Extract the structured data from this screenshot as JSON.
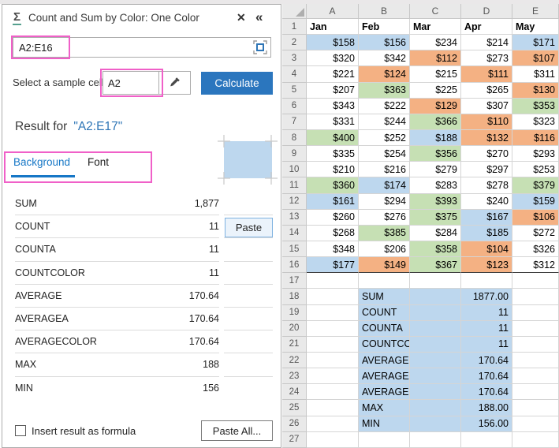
{
  "colors": {
    "annotation_pink": "#F060C8",
    "accent_blue": "#2B76BE",
    "tab_blue": "#1677C6",
    "swatch_blue": "#BDD7EE",
    "fill_blue": "#BDD7EE",
    "fill_orange": "#F4B183",
    "fill_green": "#C6E0B4"
  },
  "icons": {
    "sigma": "Σ",
    "close": "✕",
    "collapse": "«"
  },
  "panel": {
    "title": "Count and Sum by Color: One Color",
    "range_input": {
      "value": "A2:E16"
    },
    "sample_label": "Select a sample cell",
    "sample_input": {
      "value": "A2"
    },
    "calculate_button": "Calculate",
    "result_for_label": "Result for",
    "result_for_range": "\"A2:E17\"",
    "tabs": [
      {
        "label": "Background",
        "active": true
      },
      {
        "label": "Font",
        "active": false
      }
    ],
    "results": [
      {
        "label": "SUM",
        "value": "1,877"
      },
      {
        "label": "COUNT",
        "value": "11",
        "paste": true
      },
      {
        "label": "COUNTA",
        "value": "11"
      },
      {
        "label": "COUNTCOLOR",
        "value": "11"
      },
      {
        "label": "AVERAGE",
        "value": "170.64"
      },
      {
        "label": "AVERAGEA",
        "value": "170.64"
      },
      {
        "label": "AVERAGECOLOR",
        "value": "170.64"
      },
      {
        "label": "MAX",
        "value": "188"
      },
      {
        "label": "MIN",
        "value": "156"
      }
    ],
    "paste_button": "Paste",
    "footer": {
      "checkbox_label": "Insert result as formula",
      "checked": false,
      "paste_all_button": "Paste All..."
    }
  },
  "sheet": {
    "columns": [
      "A",
      "B",
      "C",
      "D",
      "E"
    ],
    "fills": {
      "b": "#BDD7EE",
      "o": "#F4B183",
      "g": "#C6E0B4",
      "w": "#FFFFFF"
    },
    "rows": [
      {
        "n": 1,
        "type": "months",
        "cells": [
          "Jan",
          "Feb",
          "Mar",
          "Apr",
          "May"
        ]
      },
      {
        "n": 2,
        "type": "data",
        "cells": [
          [
            "$158",
            "b"
          ],
          [
            "$156",
            "b"
          ],
          [
            "$234",
            "w"
          ],
          [
            "$214",
            "w"
          ],
          [
            "$171",
            "b"
          ]
        ]
      },
      {
        "n": 3,
        "type": "data",
        "cells": [
          [
            "$320",
            "w"
          ],
          [
            "$342",
            "w"
          ],
          [
            "$112",
            "o"
          ],
          [
            "$273",
            "w"
          ],
          [
            "$107",
            "o"
          ]
        ]
      },
      {
        "n": 4,
        "type": "data",
        "cells": [
          [
            "$221",
            "w"
          ],
          [
            "$124",
            "o"
          ],
          [
            "$215",
            "w"
          ],
          [
            "$111",
            "o"
          ],
          [
            "$311",
            "w"
          ]
        ]
      },
      {
        "n": 5,
        "type": "data",
        "cells": [
          [
            "$207",
            "w"
          ],
          [
            "$363",
            "g"
          ],
          [
            "$225",
            "w"
          ],
          [
            "$265",
            "w"
          ],
          [
            "$130",
            "o"
          ]
        ]
      },
      {
        "n": 6,
        "type": "data",
        "cells": [
          [
            "$343",
            "w"
          ],
          [
            "$222",
            "w"
          ],
          [
            "$129",
            "o"
          ],
          [
            "$307",
            "w"
          ],
          [
            "$353",
            "g"
          ]
        ]
      },
      {
        "n": 7,
        "type": "data",
        "cells": [
          [
            "$331",
            "w"
          ],
          [
            "$244",
            "w"
          ],
          [
            "$366",
            "g"
          ],
          [
            "$110",
            "o"
          ],
          [
            "$323",
            "w"
          ]
        ]
      },
      {
        "n": 8,
        "type": "data",
        "cells": [
          [
            "$400",
            "g"
          ],
          [
            "$252",
            "w"
          ],
          [
            "$188",
            "b"
          ],
          [
            "$132",
            "o"
          ],
          [
            "$116",
            "o"
          ]
        ]
      },
      {
        "n": 9,
        "type": "data",
        "cells": [
          [
            "$335",
            "w"
          ],
          [
            "$254",
            "w"
          ],
          [
            "$356",
            "g"
          ],
          [
            "$270",
            "w"
          ],
          [
            "$293",
            "w"
          ]
        ]
      },
      {
        "n": 10,
        "type": "data",
        "cells": [
          [
            "$210",
            "w"
          ],
          [
            "$216",
            "w"
          ],
          [
            "$279",
            "w"
          ],
          [
            "$297",
            "w"
          ],
          [
            "$253",
            "w"
          ]
        ]
      },
      {
        "n": 11,
        "type": "data",
        "cells": [
          [
            "$360",
            "g"
          ],
          [
            "$174",
            "b"
          ],
          [
            "$283",
            "w"
          ],
          [
            "$278",
            "w"
          ],
          [
            "$379",
            "g"
          ]
        ]
      },
      {
        "n": 12,
        "type": "data",
        "cells": [
          [
            "$161",
            "b"
          ],
          [
            "$294",
            "w"
          ],
          [
            "$393",
            "g"
          ],
          [
            "$240",
            "w"
          ],
          [
            "$159",
            "b"
          ]
        ]
      },
      {
        "n": 13,
        "type": "data",
        "cells": [
          [
            "$260",
            "w"
          ],
          [
            "$276",
            "w"
          ],
          [
            "$375",
            "g"
          ],
          [
            "$167",
            "b"
          ],
          [
            "$106",
            "o"
          ]
        ]
      },
      {
        "n": 14,
        "type": "data",
        "cells": [
          [
            "$268",
            "w"
          ],
          [
            "$385",
            "g"
          ],
          [
            "$284",
            "w"
          ],
          [
            "$185",
            "b"
          ],
          [
            "$272",
            "w"
          ]
        ]
      },
      {
        "n": 15,
        "type": "data",
        "cells": [
          [
            "$348",
            "w"
          ],
          [
            "$206",
            "w"
          ],
          [
            "$358",
            "g"
          ],
          [
            "$104",
            "o"
          ],
          [
            "$326",
            "w"
          ]
        ]
      },
      {
        "n": 16,
        "type": "data",
        "cells": [
          [
            "$177",
            "b"
          ],
          [
            "$149",
            "o"
          ],
          [
            "$367",
            "g"
          ],
          [
            "$123",
            "o"
          ],
          [
            "$312",
            "w"
          ]
        ]
      },
      {
        "n": 17,
        "type": "empty"
      },
      {
        "n": 18,
        "type": "summary",
        "label": "SUM",
        "value": "1877.00"
      },
      {
        "n": 19,
        "type": "summary",
        "label": "COUNT",
        "value": "11"
      },
      {
        "n": 20,
        "type": "summary",
        "label": "COUNTA",
        "value": "11"
      },
      {
        "n": 21,
        "type": "summary",
        "label": "COUNTCOLOR",
        "value": "11"
      },
      {
        "n": 22,
        "type": "summary",
        "label": "AVERAGE",
        "value": "170.64"
      },
      {
        "n": 23,
        "type": "summary",
        "label": "AVERAGEA",
        "value": "170.64"
      },
      {
        "n": 24,
        "type": "summary",
        "label": "AVERAGECOLOR",
        "value": "170.64"
      },
      {
        "n": 25,
        "type": "summary",
        "label": "MAX",
        "value": "188.00"
      },
      {
        "n": 26,
        "type": "summary",
        "label": "MIN",
        "value": "156.00"
      },
      {
        "n": 27,
        "type": "empty"
      }
    ]
  }
}
